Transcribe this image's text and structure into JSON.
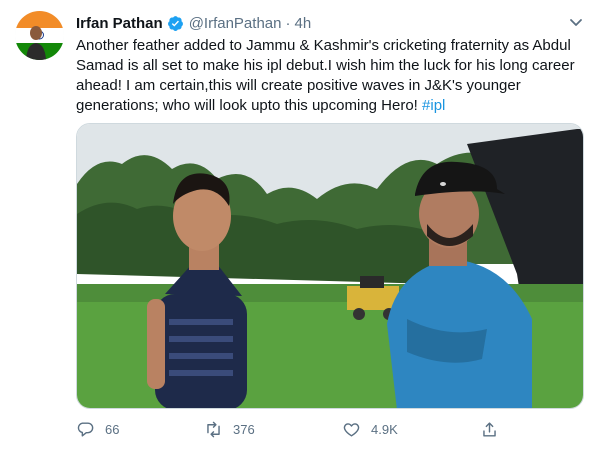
{
  "tweet": {
    "author_name": "Irfan Pathan",
    "handle": "@IrfanPathan",
    "separator": "·",
    "time": "4h",
    "text_main": "Another feather added to Jammu & Kashmir's cricketing fraternity as Abdul Samad is all set to make his ipl debut.I wish him the luck for his long career ahead! I am certain,this will create positive waves in J&K's younger generations; who will look upto this upcoming Hero! ",
    "hashtag": "#ipl"
  },
  "actions": {
    "reply_count": "66",
    "retweet_count": "376",
    "like_count": "4.9K"
  },
  "icons": {
    "verified": "verified-badge-icon",
    "more": "chevron-down-icon",
    "reply": "reply-icon",
    "retweet": "retweet-icon",
    "like": "heart-icon",
    "share": "share-icon"
  },
  "colors": {
    "accent": "#1da1f2",
    "hashtag": "#1b95e0",
    "secondary_text": "#5b7083",
    "flag_saffron": "#f28c28",
    "flag_green": "#138808"
  }
}
